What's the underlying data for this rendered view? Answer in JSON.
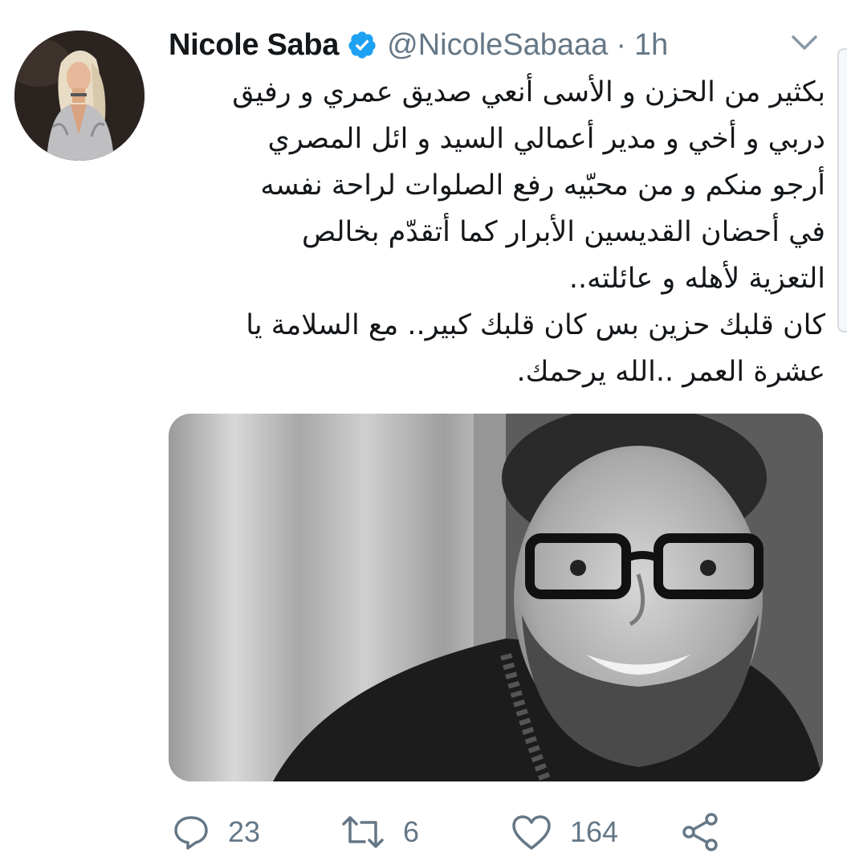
{
  "tweet": {
    "author": {
      "name": "Nicole Saba",
      "handle": "@NicoleSabaaa",
      "verified": true
    },
    "separator": "·",
    "time": "1h",
    "text_lines": [
      "بكثير من الحزن و الأسى أنعي صديق عمري و رفيق",
      "دربي و أخي و مدير أعمالي السيد و ائل المصري",
      "أرجو منكم و من محبّيه رفع الصلوات لراحة نفسه",
      "في أحضان القديسين الأبرار كما أتقدّم بخالص",
      "التعزية لأهله و عائلته..",
      "كان قلبك حزين بس كان قلبك كبير.. مع السلامة يا",
      "عشرة العمر ..الله يرحمك."
    ],
    "actions": {
      "reply": {
        "icon": "reply-icon",
        "count": "23"
      },
      "retweet": {
        "icon": "retweet-icon",
        "count": "6"
      },
      "like": {
        "icon": "heart-icon",
        "count": "164"
      },
      "share": {
        "icon": "share-icon"
      }
    }
  },
  "colors": {
    "text": "#14171a",
    "secondary": "#657786",
    "verified": "#1da1f2"
  }
}
